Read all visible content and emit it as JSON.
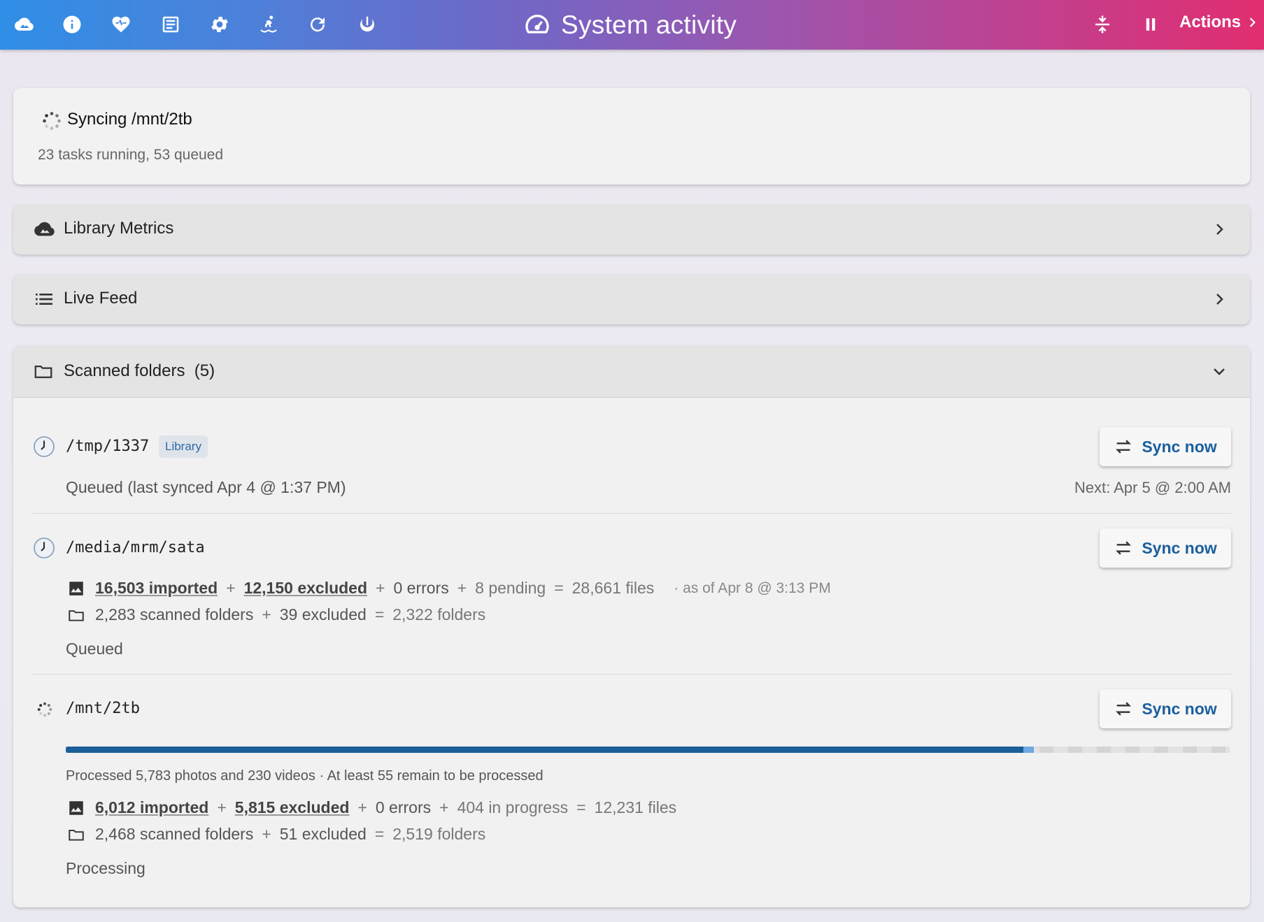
{
  "header": {
    "title": "System activity",
    "actions_label": "Actions",
    "icons": [
      "cloud-icon",
      "info-icon",
      "heart-pulse-icon",
      "log-icon",
      "settings-icon",
      "surfer-icon",
      "refresh-icon",
      "power-icon"
    ],
    "right_icons": [
      "compress-icon",
      "pause-icon"
    ],
    "gradient": [
      "#2f8ee6",
      "#e12e70"
    ]
  },
  "syncing": {
    "title": "Syncing /mnt/2tb",
    "subtitle": "23 tasks running, 53 queued"
  },
  "panels": {
    "library_metrics": "Library Metrics",
    "live_feed": "Live Feed",
    "scanned_folders": "Scanned folders",
    "scanned_count": "(5)"
  },
  "sync_now_label": "Sync now",
  "folders": [
    {
      "path": "/tmp/1337",
      "badge": "Library",
      "status": "Queued (last synced Apr 4 @ 1:37 PM)",
      "next": "Next: Apr 5 @ 2:00 AM"
    },
    {
      "path": "/media/mrm/sata",
      "files": {
        "imported": "16,503 imported",
        "excluded": "12,150 excluded",
        "errors": "0 errors",
        "pending": "8 pending",
        "total": "28,661 files",
        "as_of": "· as of Apr 8 @ 3:13 PM"
      },
      "dirs": {
        "scanned": "2,283 scanned folders",
        "excluded": "39 excluded",
        "total": "2,322 folders"
      },
      "status": "Queued"
    },
    {
      "path": "/mnt/2tb",
      "progress": {
        "value": 0.823,
        "buffer": 0.832
      },
      "processed_text": "Processed 5,783 photos and 230 videos · At least 55 remain to be processed",
      "files": {
        "imported": "6,012 imported",
        "excluded": "5,815 excluded",
        "errors": "0 errors",
        "in_progress": "404 in progress",
        "total": "12,231 files"
      },
      "dirs": {
        "scanned": "2,468 scanned folders",
        "excluded": "51 excluded",
        "total": "2,519 folders"
      },
      "status": "Processing"
    }
  ],
  "operators": {
    "plus": "+",
    "equals": "="
  }
}
